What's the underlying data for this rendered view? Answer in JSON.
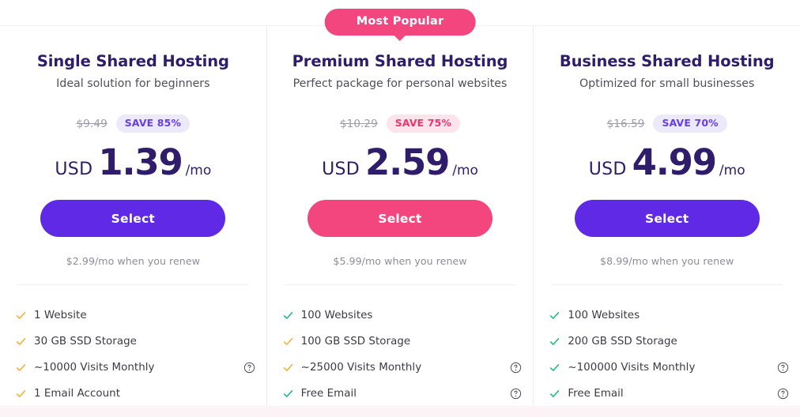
{
  "colors": {
    "purple": "#5f29e6",
    "pink": "#f4467e",
    "title_ink": "#2f1c6a",
    "check_green": "#2dbd8a",
    "check_orange": "#f5b544",
    "badge_purple_bg": "#ece9fb",
    "badge_pink_bg": "#fde4ec"
  },
  "plans": [
    {
      "popular_badge": null,
      "title": "Single Shared Hosting",
      "subtitle": "Ideal solution for beginners",
      "old_price": "$9.49",
      "save_label": "SAVE 85%",
      "save_style": "purple",
      "currency": "USD",
      "price": "1.39",
      "period": "/mo",
      "select_label": "Select",
      "select_style": "purple",
      "renew_note": "$2.99/mo when you renew",
      "features": [
        {
          "text": "1 Website",
          "check": "orange",
          "help": false
        },
        {
          "text": "30 GB SSD Storage",
          "check": "orange",
          "help": false
        },
        {
          "text": "~10000 Visits Monthly",
          "check": "orange",
          "help": true
        },
        {
          "text": "1 Email Account",
          "check": "orange",
          "help": false
        }
      ]
    },
    {
      "popular_badge": "Most Popular",
      "title": "Premium Shared Hosting",
      "subtitle": "Perfect package for personal websites",
      "old_price": "$10.29",
      "save_label": "SAVE 75%",
      "save_style": "pink",
      "currency": "USD",
      "price": "2.59",
      "period": "/mo",
      "select_label": "Select",
      "select_style": "pink",
      "renew_note": "$5.99/mo when you renew",
      "features": [
        {
          "text": "100 Websites",
          "check": "green",
          "help": false
        },
        {
          "text": "100 GB SSD Storage",
          "check": "orange",
          "help": false
        },
        {
          "text": "~25000 Visits Monthly",
          "check": "orange",
          "help": true
        },
        {
          "text": "Free Email",
          "check": "green",
          "help": true
        }
      ]
    },
    {
      "popular_badge": null,
      "title": "Business Shared Hosting",
      "subtitle": "Optimized for small businesses",
      "old_price": "$16.59",
      "save_label": "SAVE 70%",
      "save_style": "purple",
      "currency": "USD",
      "price": "4.99",
      "period": "/mo",
      "select_label": "Select",
      "select_style": "purple",
      "renew_note": "$8.99/mo when you renew",
      "features": [
        {
          "text": "100 Websites",
          "check": "green",
          "help": false
        },
        {
          "text": "200 GB SSD Storage",
          "check": "green",
          "help": false
        },
        {
          "text": "~100000 Visits Monthly",
          "check": "green",
          "help": true
        },
        {
          "text": "Free Email",
          "check": "green",
          "help": true
        }
      ]
    }
  ]
}
